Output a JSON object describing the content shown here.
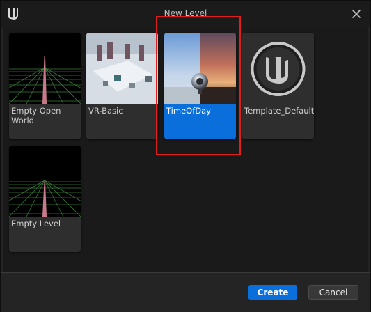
{
  "dialog": {
    "title": "New Level",
    "app_icon": "unreal-engine-logo-icon"
  },
  "templates": [
    {
      "label": "Empty Open World",
      "thumbnail": "grid-horizon-icon",
      "selected": false
    },
    {
      "label": "VR-Basic",
      "thumbnail": "vr-room-icon",
      "selected": false
    },
    {
      "label": "TimeOfDay",
      "thumbnail": "chrome-sphere-sky-icon",
      "selected": true
    },
    {
      "label": "Template_Default",
      "thumbnail": "unreal-logo-icon",
      "selected": false
    },
    {
      "label": "Empty Level",
      "thumbnail": "grid-horizon-icon",
      "selected": false
    }
  ],
  "buttons": {
    "create": "Create",
    "cancel": "Cancel"
  },
  "colors": {
    "accent": "#0a6fdb",
    "highlight": "#e01e1e"
  }
}
